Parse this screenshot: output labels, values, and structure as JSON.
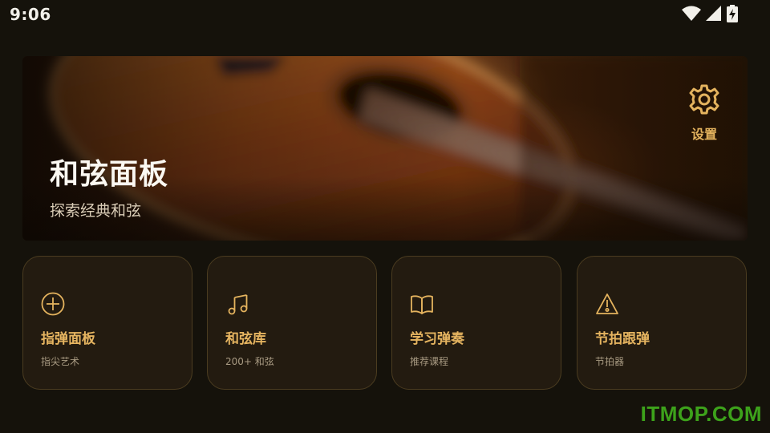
{
  "status_bar": {
    "time": "9:06",
    "icons": [
      "wifi-icon",
      "signal-icon",
      "battery-charging-icon"
    ]
  },
  "hero": {
    "title": "和弦面板",
    "subtitle": "探索经典和弦",
    "settings_label": "设置",
    "settings_icon": "gear-icon"
  },
  "cards": [
    {
      "icon": "circle-plus-icon",
      "title": "指弹面板",
      "subtitle": "指尖艺术"
    },
    {
      "icon": "music-note-icon",
      "title": "和弦库",
      "subtitle": "200+ 和弦"
    },
    {
      "icon": "open-book-icon",
      "title": "学习弹奏",
      "subtitle": "推荐课程"
    },
    {
      "icon": "metronome-icon",
      "title": "节拍跟弹",
      "subtitle": "节拍器"
    }
  ],
  "watermark": "ITMOP.COM",
  "colors": {
    "background": "#15120b",
    "accent": "#e4b35e",
    "card_background": "#231b10",
    "card_border": "#4b3c20",
    "watermark": "#3da21b"
  }
}
